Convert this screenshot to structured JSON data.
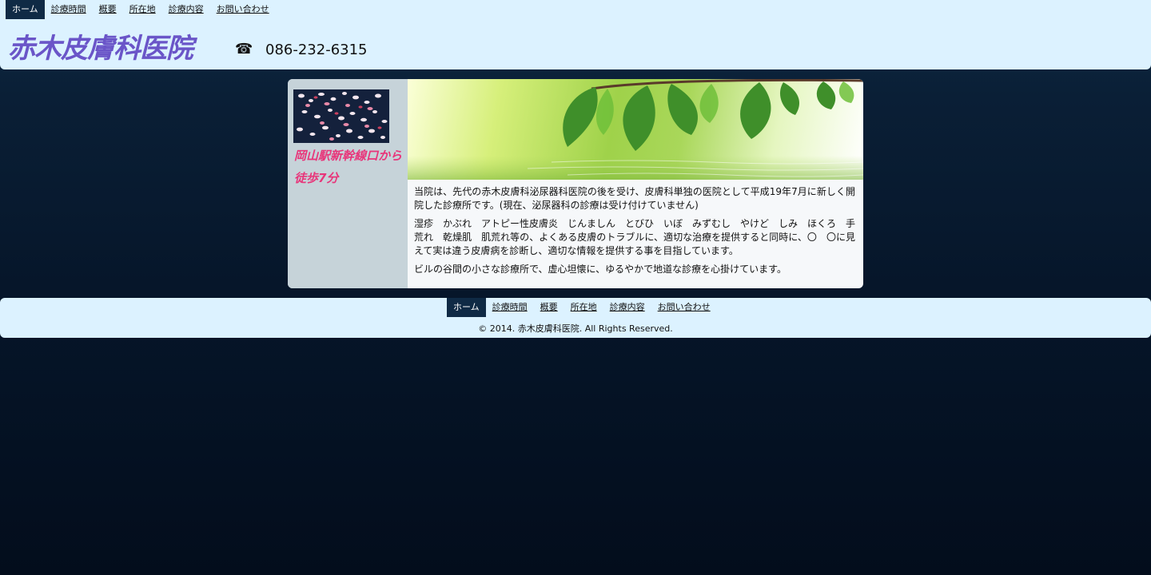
{
  "nav": {
    "items": [
      "ホーム",
      "診療時間",
      "概要",
      "所在地",
      "診療内容",
      "お問い合わせ"
    ],
    "active_index": 0
  },
  "header": {
    "title": "赤木皮膚科医院",
    "phone_icon": "phone-icon",
    "phone": "086-232-6315"
  },
  "sidebar": {
    "access": "岡山駅新幹線口から徒歩7分"
  },
  "main": {
    "paragraphs": [
      "当院は、先代の赤木皮膚科泌尿器科医院の後を受け、皮膚科単独の医院として平成19年7月に新しく開院した診療所です。(現在、泌尿器科の診療は受け付けていません)",
      "湿疹　かぶれ　アトピー性皮膚炎　じんましん　とびひ　いぼ　みずむし　やけど　しみ　ほくろ　手荒れ　乾燥肌　肌荒れ等の、よくある皮膚のトラブルに、適切な治療を提供すると同時に、〇　〇に見えて実は違う皮膚病を診断し、適切な情報を提供する事を目指しています。",
      "ビルの谷間の小さな診療所で、虚心坦懐に、ゆるやかで地道な診療を心掛けています。"
    ]
  },
  "footer": {
    "copyright": "© 2014. 赤木皮膚科医院. All Rights Reserved."
  },
  "colors": {
    "nav_active_bg": "#0f2a45",
    "title": "#6a55c8",
    "access": "#e8357a",
    "header_bg": "#dcf2ff",
    "sidebar_bg": "#c6d3d9"
  }
}
